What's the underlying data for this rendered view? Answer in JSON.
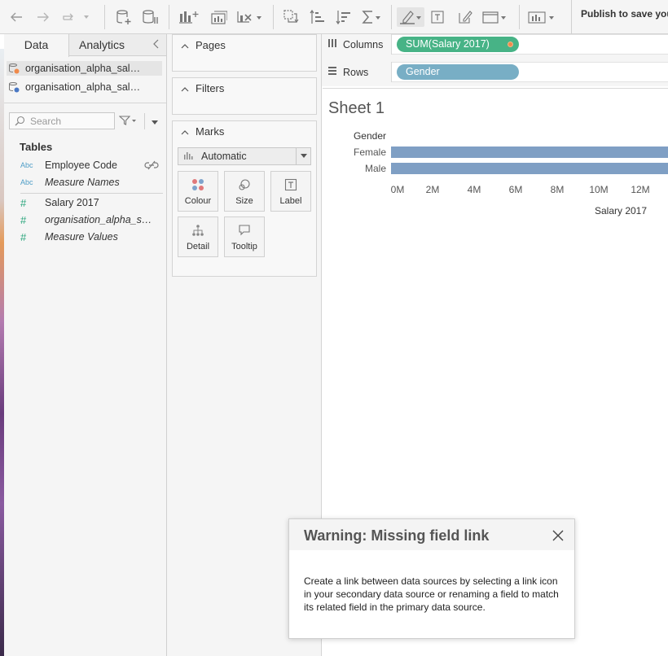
{
  "toolbar": {
    "publish_label": "Publish to save you"
  },
  "data_pane": {
    "tabs": [
      {
        "label": "Data"
      },
      {
        "label": "Analytics"
      }
    ],
    "data_sources": [
      {
        "label": "organisation_alpha_salary_data_primary",
        "status_color": "#f08a4b"
      },
      {
        "label": "organisation_alpha_salary_data_secondary",
        "status_color": "#4a78c4"
      }
    ],
    "search": {
      "placeholder": "Search"
    },
    "tables_title": "Tables",
    "fields": [
      {
        "type": "Abc",
        "name": "Employee Code",
        "italic": false,
        "linked": true
      },
      {
        "type": "Abc",
        "name": "Measure Names",
        "italic": true
      },
      {
        "type": "#",
        "name": "Salary 2017",
        "italic": false
      },
      {
        "type": "#",
        "name": "organisation_alpha_salary_data",
        "italic": true
      },
      {
        "type": "#",
        "name": "Measure Values",
        "italic": true
      }
    ]
  },
  "cards": {
    "pages": "Pages",
    "filters": "Filters",
    "marks": "Marks",
    "mark_type": "Automatic",
    "mark_buttons": [
      {
        "label": "Colour"
      },
      {
        "label": "Size"
      },
      {
        "label": "Label"
      },
      {
        "label": "Detail"
      },
      {
        "label": "Tooltip"
      }
    ]
  },
  "shelves": {
    "columns_label": "Columns",
    "columns_pill": "SUM(Salary 2017)",
    "rows_label": "Rows",
    "rows_pill": "Gender"
  },
  "sheet": {
    "title": "Sheet 1"
  },
  "chart_data": {
    "type": "bar",
    "orientation": "horizontal",
    "row_header": "Gender",
    "categories": [
      "Female",
      "Male"
    ],
    "values": [
      14500000,
      14500000
    ],
    "xlabel": "Salary 2017",
    "x_ticks": [
      "0M",
      "2M",
      "4M",
      "6M",
      "8M",
      "10M",
      "12M"
    ],
    "xlim": [
      0,
      13000000
    ],
    "bar_color": "#7f9fc4"
  },
  "dialog": {
    "title": "Warning: Missing field link",
    "body": "Create a link between data sources by selecting a link icon in your secondary data source or renaming a field to match its related field in the primary data source."
  }
}
